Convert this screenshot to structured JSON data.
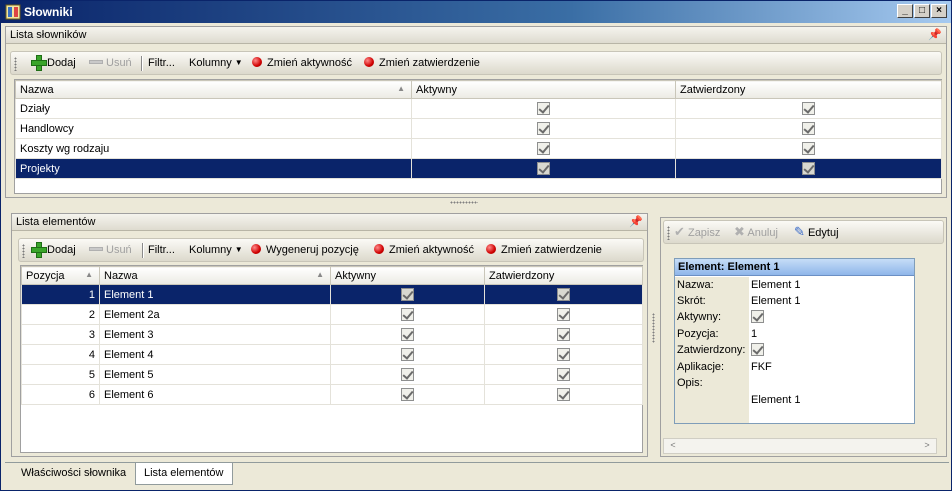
{
  "window": {
    "title": "Słowniki",
    "buttons": [
      "_",
      "□",
      "×"
    ]
  },
  "dictionaries_panel": {
    "header": "Lista słowników",
    "toolbar": {
      "add": "Dodaj",
      "remove": "Usuń",
      "filter": "Filtr...",
      "columns": "Kolumny",
      "change_active": "Zmień aktywność",
      "change_approval": "Zmień zatwierdzenie"
    },
    "columns": [
      "Nazwa",
      "Aktywny",
      "Zatwierdzony"
    ],
    "rows": [
      {
        "name": "Działy",
        "active": true,
        "approved": true
      },
      {
        "name": "Handlowcy",
        "active": true,
        "approved": true
      },
      {
        "name": "Koszty wg rodzaju",
        "active": true,
        "approved": true
      },
      {
        "name": "Projekty",
        "active": true,
        "approved": true,
        "selected": true
      }
    ]
  },
  "elements_panel": {
    "header": "Lista elementów",
    "toolbar": {
      "add": "Dodaj",
      "remove": "Usuń",
      "filter": "Filtr...",
      "columns": "Kolumny",
      "generate_position": "Wygeneruj pozycję",
      "change_active": "Zmień aktywność",
      "change_approval": "Zmień zatwierdzenie"
    },
    "columns": [
      "Pozycja",
      "Nazwa",
      "Aktywny",
      "Zatwierdzony"
    ],
    "rows": [
      {
        "pos": "1",
        "name": "Element 1",
        "selected": true
      },
      {
        "pos": "2",
        "name": "Element 2a"
      },
      {
        "pos": "3",
        "name": "Element 3"
      },
      {
        "pos": "4",
        "name": "Element 4"
      },
      {
        "pos": "5",
        "name": "Element 5"
      },
      {
        "pos": "6",
        "name": "Element 6"
      }
    ]
  },
  "detail_panel": {
    "toolbar": {
      "save": "Zapisz",
      "cancel": "Anuluj",
      "edit": "Edytuj"
    },
    "card_title": "Element: Element 1",
    "labels": {
      "name": "Nazwa:",
      "short": "Skrót:",
      "active": "Aktywny:",
      "position": "Pozycja:",
      "approved": "Zatwierdzony:",
      "applications": "Aplikacje:",
      "description": "Opis:"
    },
    "values": {
      "name": "Element 1",
      "short": "Element 1",
      "position": "1",
      "applications": "FKF",
      "description": "Element 1"
    }
  },
  "tabs": [
    "Właściwości słownika",
    "Lista elementów"
  ],
  "active_tab": "Lista elementów"
}
